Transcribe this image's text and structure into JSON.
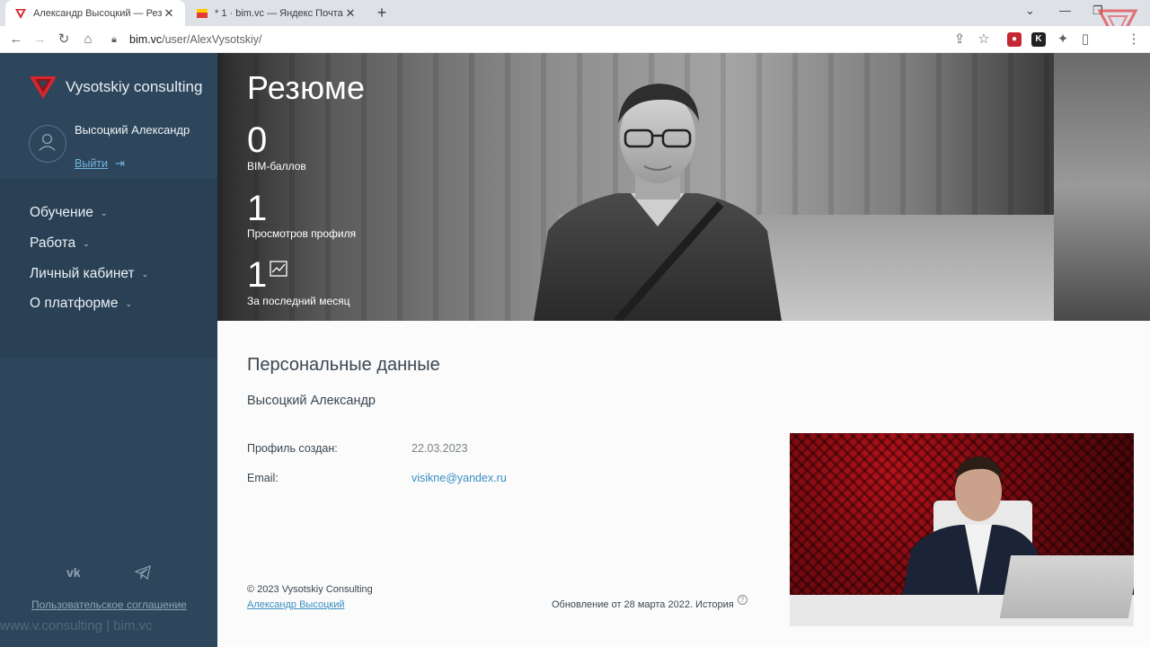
{
  "browser": {
    "tabs": [
      {
        "title": "Александр Высоцкий — Резюме",
        "active": true
      },
      {
        "title": "* 1 · bim.vc — Яндекс Почта",
        "active": false
      }
    ],
    "url_host": "bim.vc",
    "url_path": "/user/AlexVysotskiy/"
  },
  "sidebar": {
    "brand": "Vysotskiy consulting",
    "user_name": "Высоцкий Александр",
    "logout": "Выйти",
    "menu": [
      {
        "label": "Обучение"
      },
      {
        "label": "Работа"
      },
      {
        "label": "Личный кабинет"
      },
      {
        "label": "О платформе"
      }
    ],
    "agreement": "Пользовательское соглашение",
    "watermark": "www.v.consulting | bim.vc"
  },
  "hero": {
    "title": "Резюме",
    "stats": [
      {
        "value": "0",
        "label": "BIM-баллов"
      },
      {
        "value": "1",
        "label": "Просмотров профиля"
      },
      {
        "value": "1",
        "label": "За последний месяц"
      }
    ]
  },
  "personal": {
    "title": "Персональные данные",
    "name": "Высоцкий Александр",
    "created_label": "Профиль создан:",
    "created_value": "22.03.2023",
    "email_label": "Email:",
    "email_value": "visikne@yandex.ru"
  },
  "footer": {
    "copyright": "© 2023 Vysotskiy Consulting",
    "author": "Александр Высоцкий",
    "update": "Обновление от 28 марта 2022. История"
  },
  "colors": {
    "sidebar_bg": "#2e465c",
    "link": "#3a8fc4",
    "brand_red": "#d7262d"
  },
  "icons": [
    "back-arrow-icon",
    "forward-arrow-icon",
    "reload-icon",
    "home-icon",
    "lock-icon",
    "share-icon",
    "star-icon",
    "puzzle-icon",
    "user-icon",
    "logout-arrow-icon",
    "chevron-down-icon",
    "vk-icon",
    "telegram-icon",
    "chart-icon",
    "question-icon"
  ]
}
